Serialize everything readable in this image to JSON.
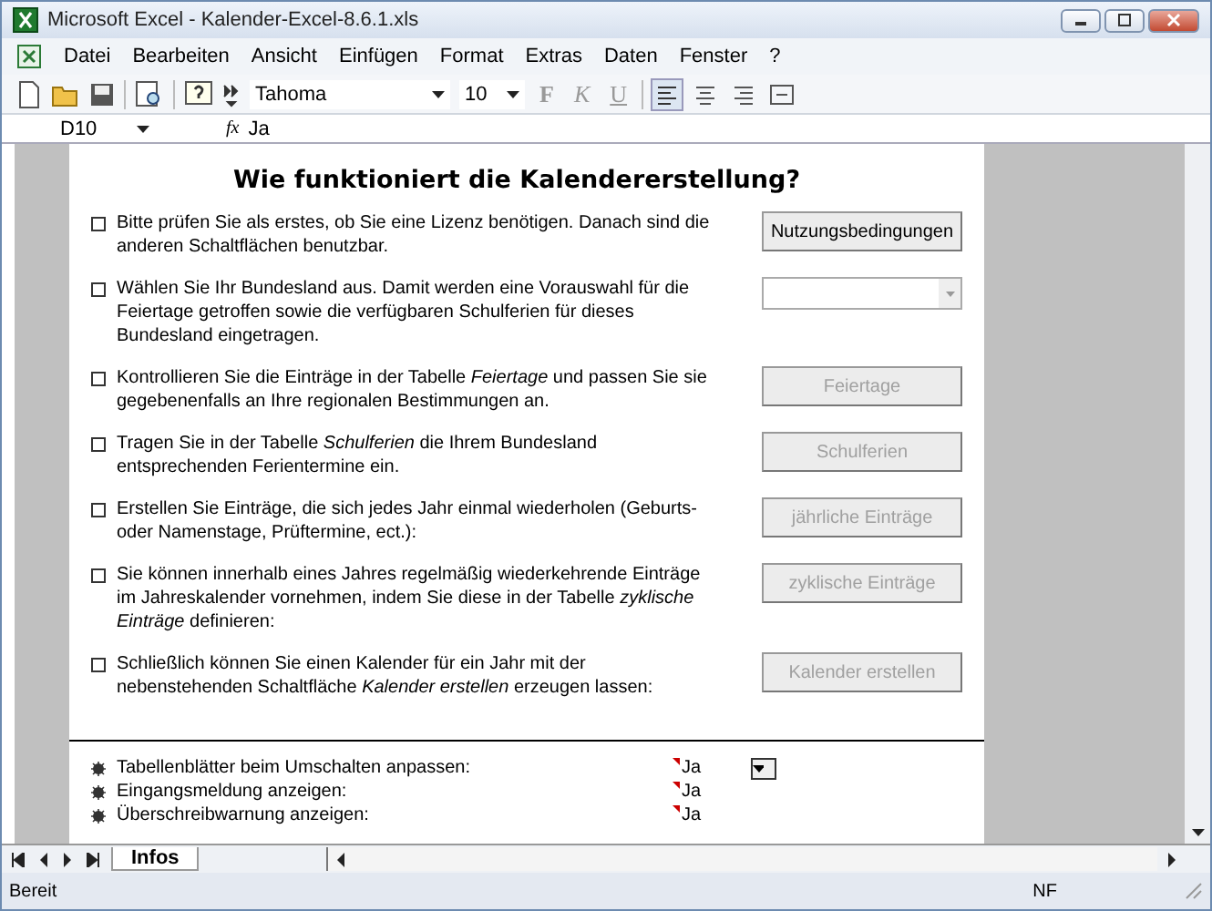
{
  "window": {
    "title": "Microsoft Excel - Kalender-Excel-8.6.1.xls"
  },
  "menu": [
    "Datei",
    "Bearbeiten",
    "Ansicht",
    "Einfügen",
    "Format",
    "Extras",
    "Daten",
    "Fenster",
    "?"
  ],
  "toolbar": {
    "font": "Tahoma",
    "size": "10",
    "bold": "F",
    "italic": "K",
    "underline": "U"
  },
  "formula_bar": {
    "cell": "D10",
    "fx": "fx",
    "value": "Ja"
  },
  "heading": "Wie funktioniert die Kalendererstellung?",
  "steps": [
    {
      "text": "Bitte prüfen Sie als erstes, ob Sie eine Lizenz benötigen. Danach sind die anderen Schaltflächen benutzbar.",
      "checked": false,
      "kind": "button",
      "label": "Nutzungsbedingungen",
      "disabled": false
    },
    {
      "text": "Wählen Sie Ihr Bundesland aus. Damit werden eine Vorauswahl für die Feiertage getroffen sowie die verfügbaren Schulferien für dieses Bundesland eingetragen.",
      "checked": false,
      "kind": "dropdown"
    },
    {
      "text": "Kontrollieren Sie die Einträge in der Tabelle *Feiertage* und passen Sie sie gegebenenfalls an Ihre regionalen Bestimmungen an.",
      "checked": false,
      "kind": "button",
      "label": "Feiertage",
      "disabled": true
    },
    {
      "text": "Tragen Sie in der Tabelle *Schulferien* die Ihrem Bundesland entsprechenden Ferientermine ein.",
      "checked": false,
      "kind": "button",
      "label": "Schulferien",
      "disabled": true
    },
    {
      "text": "Erstellen Sie Einträge, die sich jedes Jahr einmal wiederholen (Geburts- oder Namenstage, Prüftermine, ect.):",
      "checked": false,
      "kind": "button",
      "label": "jährliche Einträge",
      "disabled": true
    },
    {
      "text": "Sie können innerhalb eines Jahres regelmäßig wiederkehrende Einträge im Jahreskalender vornehmen, indem Sie diese in der Tabelle *zyklische Einträge* definieren:",
      "checked": false,
      "kind": "button",
      "label": "zyklische Einträge",
      "disabled": true
    },
    {
      "text": "Schließlich können Sie einen Kalender für ein Jahr mit der nebenstehenden Schaltfläche *Kalender erstellen* erzeugen lassen:",
      "checked": false,
      "kind": "button",
      "label": "Kalender erstellen",
      "disabled": true
    }
  ],
  "settings": [
    {
      "label": "Tabellenblätter beim Umschalten anpassen:",
      "value": "Ja",
      "comment": true,
      "dropdown": true
    },
    {
      "label": "Eingangsmeldung anzeigen:",
      "value": "Ja",
      "comment": true,
      "dropdown": false
    },
    {
      "label": "Überschreibwarnung anzeigen:",
      "value": "Ja",
      "comment": true,
      "dropdown": false
    }
  ],
  "sheet_tabs": [
    {
      "label": "Infos",
      "selected": true
    }
  ],
  "status_bar": {
    "left": "Bereit",
    "right": "NF"
  }
}
